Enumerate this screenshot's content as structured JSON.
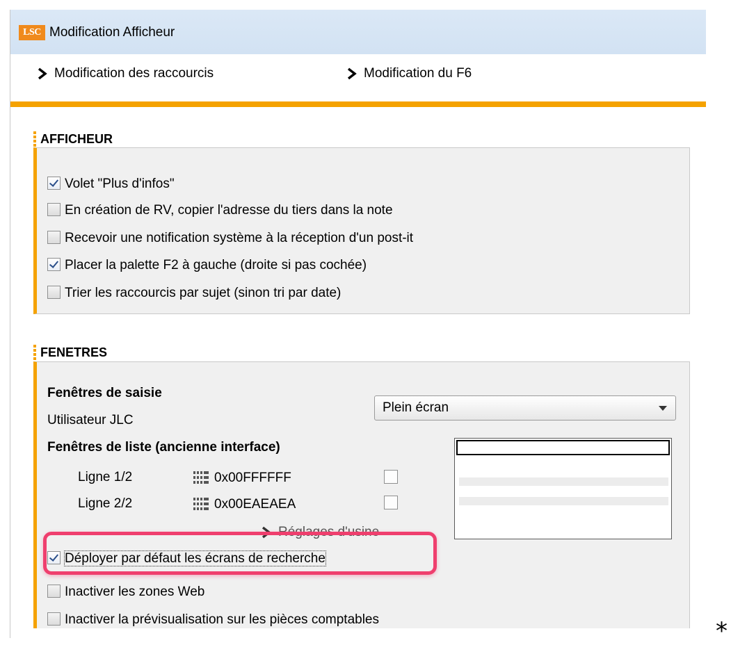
{
  "window": {
    "logo_text": "LSC",
    "title": "Modification Afficheur"
  },
  "menu": {
    "items": [
      {
        "label": "Modification des raccourcis"
      },
      {
        "label": "Modification du F6"
      }
    ]
  },
  "afficheur": {
    "heading": "AFFICHEUR",
    "options": [
      {
        "label": "Volet \"Plus d'infos\"",
        "checked": true
      },
      {
        "label": "En création de RV, copier l'adresse du tiers dans la note",
        "checked": false
      },
      {
        "label": "Recevoir une notification système à la réception d'un post-it",
        "checked": false
      },
      {
        "label": "Placer la palette F2 à gauche (droite si pas cochée)",
        "checked": true
      },
      {
        "label": "Trier les raccourcis par sujet (sinon tri par date)",
        "checked": false
      }
    ]
  },
  "fenetres": {
    "heading": "FENETRES",
    "saisie_heading": "Fenêtres de saisie",
    "user_label": "Utilisateur JLC",
    "mode_select": {
      "value": "Plein écran"
    },
    "liste_heading": "Fenêtres de liste (ancienne interface)",
    "lines": [
      {
        "label": "Ligne 1/2",
        "color": "0x00FFFFFF",
        "checked": false
      },
      {
        "label": "Ligne 2/2",
        "color": "0x00EAEAEA",
        "checked": false
      }
    ],
    "factory_reset": "Réglages d'usine",
    "options": [
      {
        "label": "Déployer par défaut les écrans de recherche",
        "checked": true
      },
      {
        "label": "Inactiver les zones Web",
        "checked": false
      },
      {
        "label": "Inactiver la prévisualisation sur les pièces comptables",
        "checked": false
      }
    ]
  },
  "footnote": "*",
  "colors": {
    "accent": "#f5a200",
    "highlight": "#ef3f6e",
    "titlebar": "#d6e5f5",
    "panel": "#f0f0f0"
  }
}
